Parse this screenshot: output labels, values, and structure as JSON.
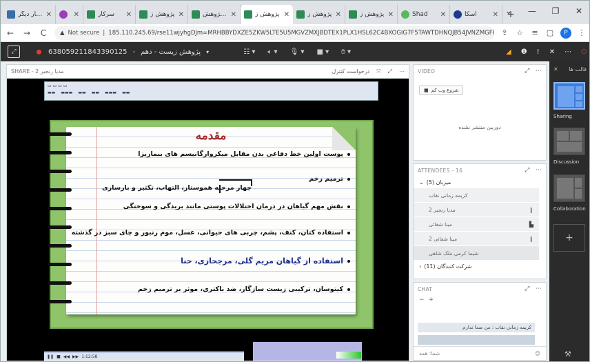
{
  "browser": {
    "tabs": [
      {
        "title": "سرکار ديگر",
        "icon": "grid"
      },
      {
        "title": "",
        "icon": "purple"
      },
      {
        "title": "سرکار",
        "icon": "green"
      },
      {
        "title": "پژوهش ز",
        "icon": "green"
      },
      {
        "title": "پژوهش ..",
        "icon": "green"
      },
      {
        "title": "پژوهش ز",
        "icon": "green",
        "active": true
      },
      {
        "title": "پژوهش ز",
        "icon": "green"
      },
      {
        "title": "پژوهش ز",
        "icon": "green"
      },
      {
        "title": "Shad",
        "icon": "green2"
      },
      {
        "title": "اسکا",
        "icon": "blue"
      }
    ],
    "close_glyph": "✕",
    "new_tab_glyph": "+",
    "window_controls": [
      "⌄",
      "—",
      "❐",
      "✕"
    ],
    "nav": {
      "back": "←",
      "forward": "→",
      "reload": "C"
    },
    "url_security_label": "Not secure",
    "url": "185.110.245.69/rse11wjyhgDJm=MRHBBYDXZE5ZKW5LTE5U5MGVZMXJBDTEX1PLX1HSL62C4BXOGIG7F5TAWTDHNQJB54JVNZMGFPHT2..."
  },
  "app": {
    "toolbar": {
      "meeting_id": "638059211843390125",
      "meeting_title": "پژوهش زیست - دهم",
      "caret": "▾"
    },
    "share_pod": {
      "label": "SHARE - مدیا رنجبر 2",
      "request_control": "درخواست کنترل"
    },
    "slide": {
      "title": "مقدمه",
      "bullets": [
        "پوست اولین خط دفاعی بدن مقابل میکروارگانیسم های بیماریزا",
        "ترمیم زخم",
        "نقش مهم گیاهان در درمان اختلالات پوستی مانند بریدگی و سوختگی",
        "استفاده کتان، کنف، پشم، چربی های حیوانی، عسل، موم زنبور و چای سبز در گذشته",
        "استفاده از گیاهان مریم گلی، مرجحازی، حنا",
        "کیتوسان، ترکیبی زیست سازگار، ضد باکتری، موثر بر ترمیم زخم"
      ],
      "sub_note": "چهار مرحله هموستاز، التهاب، تکثیر و بازسازی"
    },
    "player": {
      "time": "1:12:58"
    },
    "video_pod": {
      "label": "VIDEO",
      "start_button": "شروع وب کم",
      "message": "دوربین منتشر نشده"
    },
    "attendees_pod": {
      "label": "ATTENDEES - 16",
      "group_hosts": "میزبان (5)",
      "hosts": [
        "کریمه زمانی نقاب",
        "مدیا رنجبر 2",
        "مینا شفائی",
        "مینا شفائی 2",
        "شیما کرمی ملک شاهی"
      ],
      "group_participants": "شرکت کنندگان (11)"
    },
    "chat_pod": {
      "label": "CHAT",
      "message_preview": "کریمه زمانی نقاب : من صدا ندارم",
      "input_placeholder": "شما: همه"
    },
    "layouts_panel": {
      "label": "قالب ها",
      "layouts": [
        "Sharing",
        "Discussion",
        "Collaboration"
      ]
    }
  }
}
